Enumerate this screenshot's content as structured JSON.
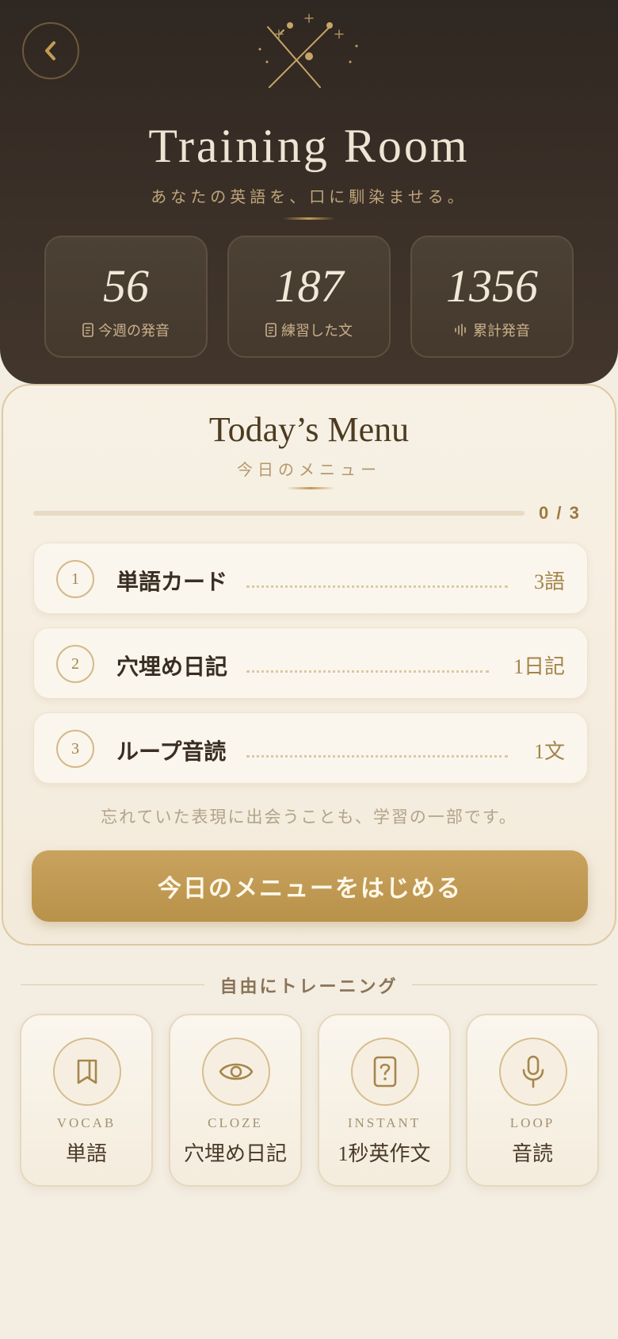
{
  "header": {
    "title": "Training Room",
    "subtitle": "あなたの英語を、口に馴染ませる。",
    "stats": [
      {
        "value": "56",
        "label": "今週の発音",
        "icon": "document-icon"
      },
      {
        "value": "187",
        "label": "練習した文",
        "icon": "document-icon"
      },
      {
        "value": "1356",
        "label": "累計発音",
        "icon": "waveform-icon"
      }
    ]
  },
  "menu": {
    "title": "Today’s Menu",
    "subtitle": "今日のメニュー",
    "progress_text": "0 / 3",
    "progress_fraction": 0,
    "items": [
      {
        "num": "1",
        "name": "単語カード",
        "count": "3語"
      },
      {
        "num": "2",
        "name": "穴埋め日記",
        "count": "1日記"
      },
      {
        "num": "3",
        "name": "ループ音読",
        "count": "1文"
      }
    ],
    "hint": "忘れていた表現に出会うことも、学習の一部です。",
    "start_label": "今日のメニューをはじめる"
  },
  "free": {
    "title": "自由にトレーニング",
    "tiles": [
      {
        "en": "VOCAB",
        "jp": "単語",
        "icon": "book-icon"
      },
      {
        "en": "CLOZE",
        "jp": "穴埋め日記",
        "icon": "eye-icon"
      },
      {
        "en": "INSTANT",
        "jp": "1秒英作文",
        "icon": "question-card-icon"
      },
      {
        "en": "LOOP",
        "jp": "音読",
        "icon": "microphone-icon"
      }
    ]
  },
  "colors": {
    "accent": "#c49a55",
    "header_bg": "#3b3028",
    "card_bg": "#f7f1e5"
  }
}
